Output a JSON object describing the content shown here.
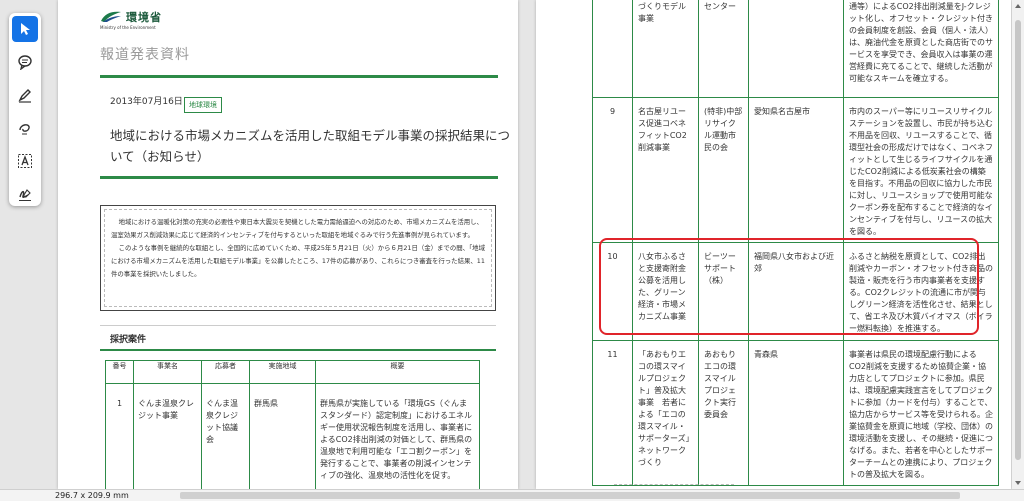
{
  "toolbar": {
    "tools": [
      {
        "name": "select-tool",
        "icon": "cursor-icon"
      },
      {
        "name": "comment-tool",
        "icon": "comment-icon"
      },
      {
        "name": "highlight-tool",
        "icon": "pen-icon"
      },
      {
        "name": "draw-tool",
        "icon": "freehand-icon"
      },
      {
        "name": "text-select-tool",
        "icon": "text-box-icon"
      },
      {
        "name": "sign-tool",
        "icon": "signature-icon"
      }
    ]
  },
  "page1": {
    "logo_text": "環境省",
    "logo_subtext": "Ministry of the Environment",
    "report_label": "報道発表資料",
    "date": "2013年07月16日",
    "tag": "地球環境",
    "title": "地域における市場メカニズムを活用した取組モデル事業の採択結果について（お知らせ）",
    "summary_paragraphs": [
      "地域における温暖化対策の充実の必要性や東日本大震災を契機とした電力需給逼迫への対応のため、市場メカニズムを活用し、温室効果ガス削減効果に応じて経済的インセンティブを付与するといった取組を地域ぐるみで行う先進事例が見られています。",
      "このような事例を継続的な取組とし、全国的に広めていくため、平成25年５月21日（火）から６月21日（金）までの間、「地域における市場メカニズムを活用した取組モデル事業」を公募したところ、17件の応募があり、これらにつき審査を行った結果、11件の事業を採択いたしました。"
    ],
    "section_heading": "採択案件",
    "table_headers": [
      "番号",
      "事業名",
      "応募者",
      "実施地域",
      "概要"
    ],
    "rows": [
      {
        "no": "1",
        "project": "ぐんま温泉クレジット事業",
        "applicant": "ぐんま温泉クレジット協議会",
        "region": "群馬県",
        "summary": "群馬県が実施している「環境GS（ぐんまスタンダード）認定制度」におけるエネルギー使用状況報告制度を活用し、事業者によるCO2排出削減の対価として、群馬県の温泉地で利用可能な「エコ割クーポン」を発行することで、事業者の削減インセンティブの強化、温泉地の活性化を促す。"
      }
    ]
  },
  "page2": {
    "rows": [
      {
        "no": "",
        "project": "づくりモデル事業",
        "applicant": "センター",
        "region": "",
        "summary": "通等）によるCO2排出削減量をJ-クレジット化し、オフセット・クレジット付きの会員制度を創設、会員（個人・法人）は、廃油代金を原資とした商店街でのサービスを享受でき、会員収入は事業の運営経費に充てることで、継続した活動が可能なスキームを確立する。"
      },
      {
        "no": "9",
        "project": "名古屋リユース促進コベネフィットCO2削減事業",
        "applicant": "(特非)中部リサイクル運動市民の会",
        "region": "愛知県名古屋市",
        "summary": "市内のスーパー等にリユースリサイクルステーションを設置し、市民が持ち込む不用品を回収、リユースすることで、循環型社会の形成だけではなく、コベネフィットとして生じるライフサイクルを通じたCO2削減による低炭素社会の構築を目指す。不用品の回収に協力した市民に対し、リユースショップで使用可能なクーポン券を配布することで経済的なインセンティブを付与し、リユースの拡大を図る。"
      },
      {
        "no": "10",
        "project": "八女市ふるさと支援寄附金公募を活用した、グリーン経済・市場メカニズム事業",
        "applicant": "ビーツーサポート（株）",
        "region": "福岡県八女市および近郊",
        "summary": "ふるさと納税を原資として、CO2排出削減やカーボン・オフセット付き商品の製造・販売を行う市内事業者を支援する。CO2クレジットの流通に市が関与しグリーン経済を活性化させ、結果として、省エネ及び木質バイオマス（ボイラー燃料転換）を推進する。"
      },
      {
        "no": "11",
        "project": "「あおもりエコの環スマイルプロジェクト」普及拡大事業　若者による「エコの環スマイル・サポーターズ」ネットワークづくり",
        "applicant": "あおもりエコの環スマイルプロジェクト実行委員会",
        "region": "青森県",
        "summary": "事業者は県民の環境配慮行動によるCO2削減を支援するため協賛企業・協力店としてプロジェクトに参加。県民は、環境配慮実践宣言をしてプロジェクトに参加（カードを付与）することで、協力店からサービス等を受けられる。企業協賛金を原資に地域（学校、団体）の環境活動を支援し、その継続・促進につなげる。また、若者を中心としたサポーターチームとの連携により、プロジェクトの普及拡大を図る。"
      }
    ]
  },
  "status": {
    "page_size": "296.7 x 209.9 mm"
  },
  "colors": {
    "accent_blue": "#1473e6",
    "brand_green": "#2d8a47",
    "highlight_red": "#e0242a"
  }
}
